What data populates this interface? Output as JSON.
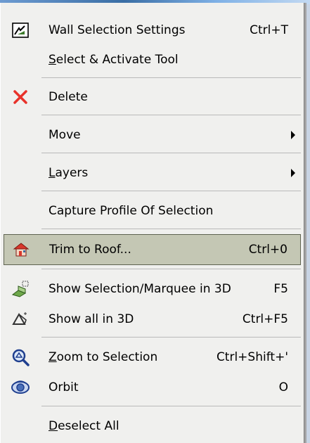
{
  "menu": {
    "items": [
      {
        "label": "Wall Selection Settings",
        "shortcut": "Ctrl+T",
        "icon": "wall-settings-icon"
      },
      {
        "label": "Select & Activate Tool",
        "shortcut": "",
        "icon": "",
        "mnemonic": "S"
      },
      {
        "label": "Delete",
        "shortcut": "",
        "icon": "delete-x-icon"
      },
      {
        "label": "Move",
        "shortcut": "",
        "icon": "",
        "submenu": true
      },
      {
        "label": "Layers",
        "shortcut": "",
        "icon": "",
        "submenu": true,
        "mnemonic": "L"
      },
      {
        "label": "Capture Profile Of Selection",
        "shortcut": "",
        "icon": ""
      },
      {
        "label": "Trim to Roof...",
        "shortcut": "Ctrl+0",
        "icon": "trim-to-roof-icon",
        "highlighted": true
      },
      {
        "label": "Show Selection/Marquee in 3D",
        "shortcut": "F5",
        "icon": "show-selection-3d-icon"
      },
      {
        "label": "Show all in 3D",
        "shortcut": "Ctrl+F5",
        "icon": "show-all-3d-icon"
      },
      {
        "label": "Zoom to Selection",
        "shortcut": "Ctrl+Shift+'",
        "icon": "zoom-selection-icon",
        "mnemonic": "Z"
      },
      {
        "label": "Orbit",
        "shortcut": "O",
        "icon": "orbit-icon"
      },
      {
        "label": "Deselect All",
        "shortcut": "",
        "icon": "",
        "mnemonic": "D"
      }
    ]
  },
  "colors": {
    "menu_bg": "#f0f0ee",
    "highlight_bg": "#c4c7b4",
    "delete_red": "#e8322a"
  }
}
